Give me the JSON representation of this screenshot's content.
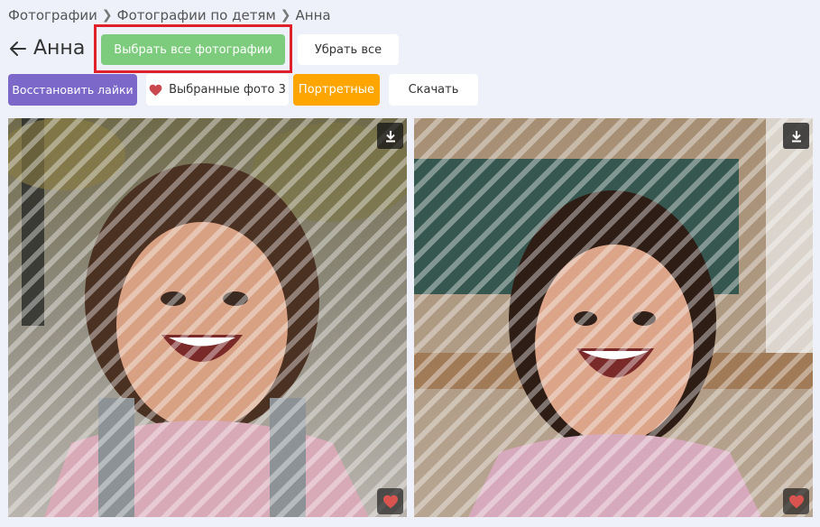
{
  "breadcrumb": {
    "items": [
      "Фотографии",
      "Фотографии по детям"
    ],
    "current": "Анна"
  },
  "header": {
    "title": "Анна"
  },
  "toolbar": {
    "select_all": "Выбрать все фотографии",
    "remove_all": "Убрать все",
    "restore_likes": "Восстановить лайки",
    "favorites": "Выбранные фото 3",
    "portraits": "Портретные",
    "download": "Скачать"
  },
  "colors": {
    "accent_green": "#7dcc7d",
    "accent_purple": "#7b68c9",
    "accent_orange": "#ffa500",
    "heart": "#d9534f",
    "highlight": "#e0202a"
  },
  "photos": [
    {
      "icons": [
        "download-icon",
        "heart-icon"
      ]
    },
    {
      "icons": [
        "download-icon",
        "heart-icon"
      ]
    }
  ]
}
